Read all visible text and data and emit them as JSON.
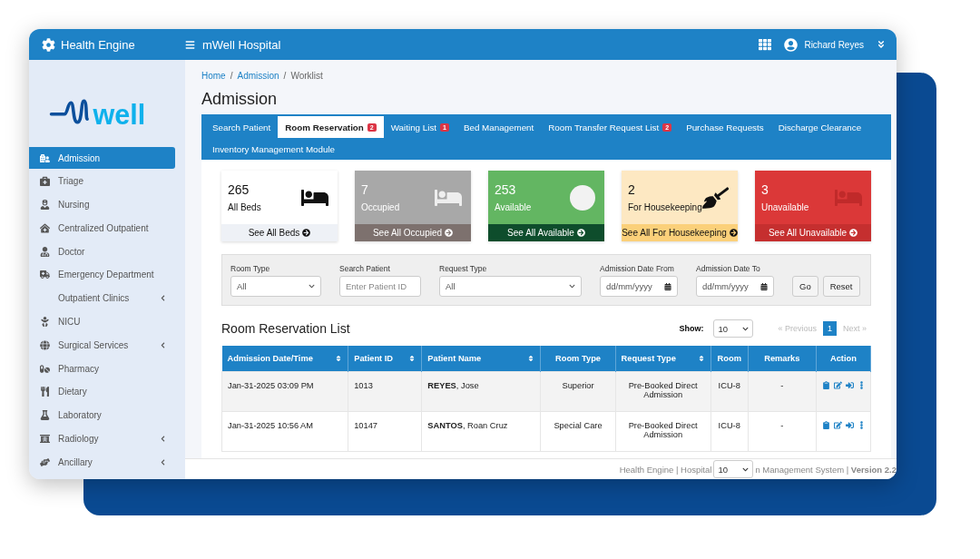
{
  "header": {
    "app_name": "Health Engine",
    "hospital": "mWell Hospital",
    "user": "Richard Reyes"
  },
  "sidebar": {
    "logo_text": "well",
    "items": [
      {
        "label": "Admission",
        "selected": true,
        "expandable": false
      },
      {
        "label": "Triage",
        "selected": false,
        "expandable": false
      },
      {
        "label": "Nursing",
        "selected": false,
        "expandable": false
      },
      {
        "label": "Centralized Outpatient",
        "selected": false,
        "expandable": false
      },
      {
        "label": "Doctor",
        "selected": false,
        "expandable": false
      },
      {
        "label": "Emergency Department",
        "selected": false,
        "expandable": false
      },
      {
        "label": "Outpatient Clinics",
        "selected": false,
        "expandable": true
      },
      {
        "label": "NICU",
        "selected": false,
        "expandable": false
      },
      {
        "label": "Surgical Services",
        "selected": false,
        "expandable": true
      },
      {
        "label": "Pharmacy",
        "selected": false,
        "expandable": false
      },
      {
        "label": "Dietary",
        "selected": false,
        "expandable": false
      },
      {
        "label": "Laboratory",
        "selected": false,
        "expandable": false
      },
      {
        "label": "Radiology",
        "selected": false,
        "expandable": true
      },
      {
        "label": "Ancillary",
        "selected": false,
        "expandable": true
      }
    ]
  },
  "breadcrumb": [
    {
      "label": "Home",
      "link": true
    },
    {
      "label": "Admission",
      "link": true
    },
    {
      "label": "Worklist",
      "link": false
    }
  ],
  "breadcrumb_separator": "/",
  "page_title": "Admission",
  "tabs": [
    {
      "label": "Search Patient",
      "selected": false
    },
    {
      "label": "Room Reservation",
      "selected": true,
      "badge": "2"
    },
    {
      "label": "Waiting List",
      "selected": false,
      "badge": "1"
    },
    {
      "label": "Bed Management",
      "selected": false
    },
    {
      "label": "Room Transfer Request List",
      "selected": false,
      "badge": "2"
    },
    {
      "label": "Purchase Requests",
      "selected": false
    },
    {
      "label": "Discharge Clearance",
      "selected": false
    },
    {
      "label": "Inventory Management Module",
      "selected": false
    }
  ],
  "stat_cards": [
    {
      "kind": "all",
      "count": "265",
      "label": "All Beds",
      "link": "See All Beds"
    },
    {
      "kind": "occupied",
      "count": "7",
      "label": "Occupied",
      "link": "See All Occupied"
    },
    {
      "kind": "available",
      "count": "253",
      "label": "Available",
      "link": "See All Available"
    },
    {
      "kind": "housekeeping",
      "count": "2",
      "label": "For Housekeeping",
      "link": "See All For Housekeeping"
    },
    {
      "kind": "unavailable",
      "count": "3",
      "label": "Unavailable",
      "link": "See All Unavailable"
    }
  ],
  "filters": [
    {
      "kind": "select",
      "label": "Room Type",
      "value": "All"
    },
    {
      "kind": "input",
      "label": "Search Patient",
      "placeholder": "Enter Patient ID"
    },
    {
      "kind": "select",
      "label": "Request Type",
      "value": "All"
    },
    {
      "kind": "date",
      "label": "Admission Date From",
      "placeholder": "dd/mm/yyyy"
    },
    {
      "kind": "date",
      "label": "Admission Date To",
      "placeholder": "dd/mm/yyyy"
    }
  ],
  "filter_buttons": [
    "Go",
    "Reset"
  ],
  "list": {
    "title": "Room Reservation List",
    "show_label": "Show:",
    "show_value": "10",
    "pagination": [
      {
        "label": "« Previous",
        "selected": false,
        "disabled": true
      },
      {
        "label": "1",
        "selected": true,
        "disabled": false
      },
      {
        "label": "Next »",
        "selected": false,
        "disabled": true
      }
    ]
  },
  "table": {
    "columns": [
      {
        "label": "Admission Date/Time",
        "sortable": true
      },
      {
        "label": "Patient ID",
        "sortable": true
      },
      {
        "label": "Patient Name",
        "sortable": true
      },
      {
        "label": "Room Type",
        "sortable": false
      },
      {
        "label": "Request Type",
        "sortable": true
      },
      {
        "label": "Room",
        "sortable": false
      },
      {
        "label": "Remarks",
        "sortable": false
      },
      {
        "label": "Action",
        "sortable": false
      }
    ],
    "rows": [
      {
        "cells": [
          "Jan-31-2025 03:09 PM",
          "1013",
          "**REYES**, Jose",
          "Superior",
          "Pre-Booked Direct Admission",
          "ICU-8",
          "-"
        ]
      },
      {
        "cells": [
          "Jan-31-2025 10:56 AM",
          "10147",
          "**SANTOS**, Roan Cruz",
          "Special Care",
          "Pre-Booked Direct Admission",
          "ICU-8",
          "-"
        ]
      }
    ]
  },
  "footer": {
    "left": "Health Engine | Hospital",
    "select_value": "10",
    "right": "n Management System | **Version 2.2**"
  }
}
